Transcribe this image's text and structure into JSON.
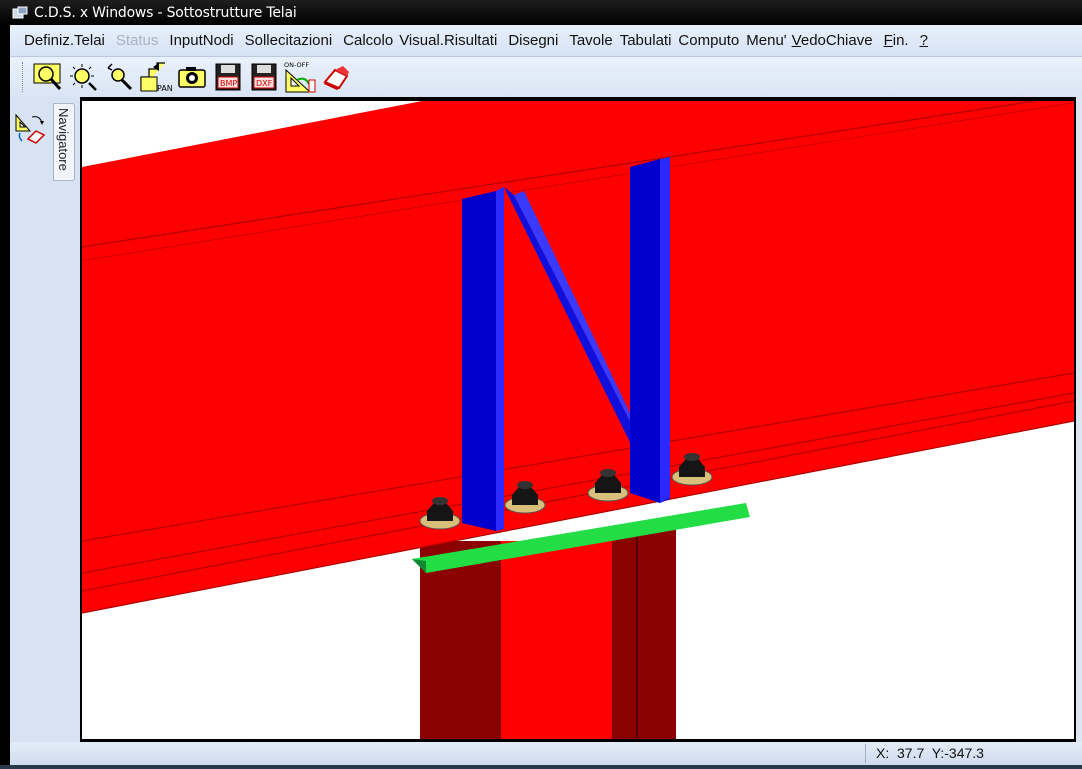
{
  "window": {
    "title": "C.D.S. x Windows - Sottostrutture Telai",
    "app_icon": "cds-app-icon"
  },
  "menu": {
    "items": [
      {
        "label": "Definiz.Telai",
        "enabled": true
      },
      {
        "label": "Status",
        "enabled": false
      },
      {
        "label": "InputNodi",
        "enabled": true
      },
      {
        "label": "Sollecitazioni",
        "enabled": true
      },
      {
        "label": "Calcolo",
        "enabled": true
      },
      {
        "label": "Visual.Risultati",
        "enabled": true
      },
      {
        "label": "Disegni",
        "enabled": true
      },
      {
        "label": "Tavole",
        "enabled": true
      },
      {
        "label": "Tabulati",
        "enabled": true
      },
      {
        "label": "Computo",
        "enabled": true
      },
      {
        "label": "Menu'",
        "enabled": true
      }
    ],
    "vedochiave": {
      "first": "V",
      "rest": "edoChiave"
    },
    "fin": {
      "first": "F",
      "rest": "in."
    },
    "help": "?"
  },
  "toolbar": {
    "buttons": [
      {
        "icon": "zoom-window-icon"
      },
      {
        "icon": "zoom-all-icon"
      },
      {
        "icon": "zoom-out-icon"
      },
      {
        "icon": "pan-icon",
        "label": "PAN"
      },
      {
        "icon": "camera-icon"
      },
      {
        "icon": "save-bmp-icon",
        "label": "BMP"
      },
      {
        "icon": "save-dxf-icon",
        "label": "DXF"
      },
      {
        "icon": "on-off-toggle-icon",
        "label": "ON-OFF"
      },
      {
        "icon": "eraser-icon"
      }
    ]
  },
  "navigator": {
    "tab_label": "Navigatore",
    "icon": "navigator-tool-icon"
  },
  "viewport": {
    "scene": "3d-steel-beam-column-joint",
    "colors": {
      "beam": "#ff0000",
      "beam_edge": "#a00000",
      "stiffener": "#0000cc",
      "plate": "#22dd44",
      "column_dark": "#8b0000",
      "bolt": "#111111"
    }
  },
  "status": {
    "x_label": "X:",
    "x_value": "37.7",
    "y_label": "Y:",
    "y_value": "-347.3"
  }
}
